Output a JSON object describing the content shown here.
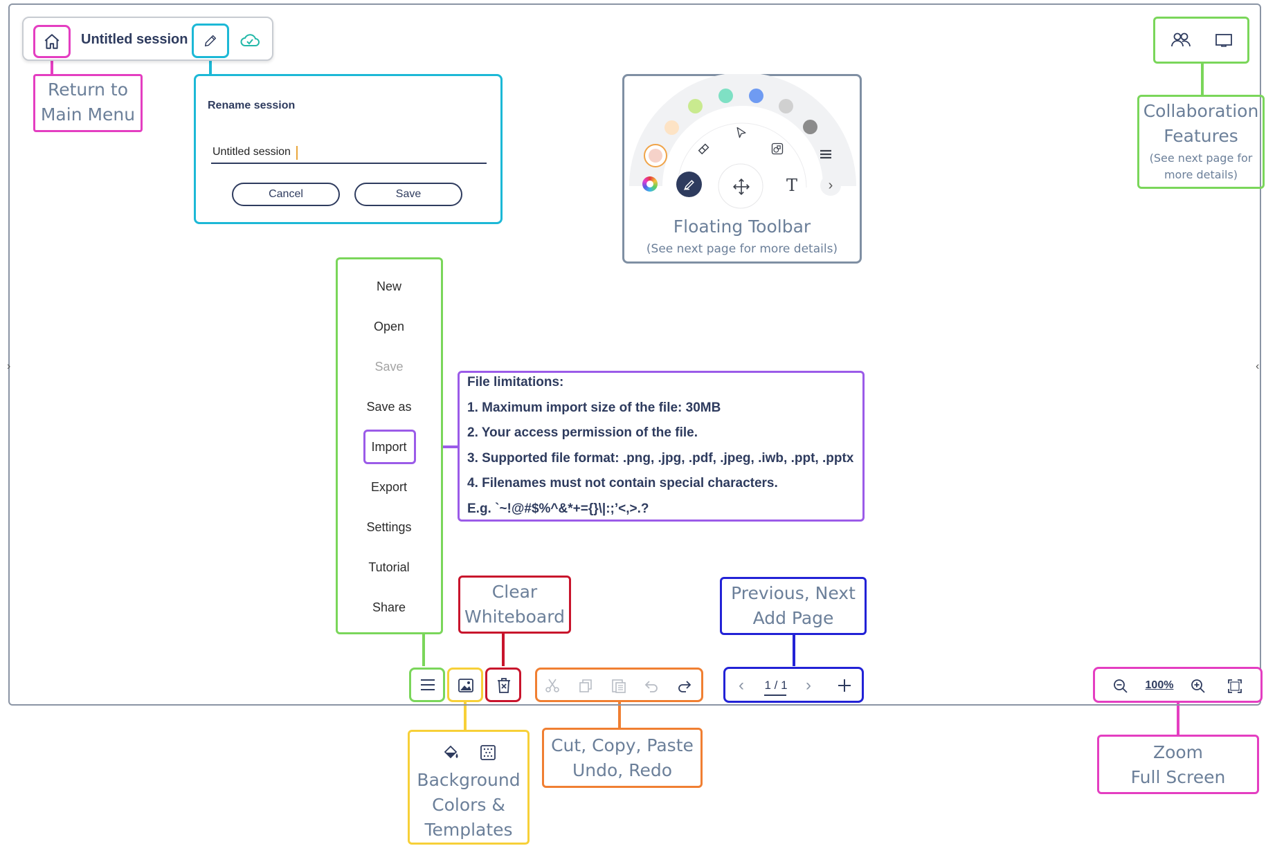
{
  "session": {
    "title": "Untitled session",
    "icons": [
      "home-icon",
      "pencil-icon",
      "cloud-check-icon"
    ]
  },
  "rename_dialog": {
    "title": "Rename session",
    "value": "Untitled session",
    "cancel_label": "Cancel",
    "save_label": "Save"
  },
  "floating_toolbar": {
    "label": "Floating Toolbar",
    "sublabel": "(See next page for more details)",
    "palette": [
      "#f6d2c9",
      "#fde3c5",
      "#c9ea8f",
      "#7fe0c4",
      "#6f9bf2",
      "#d0d0d0",
      "#8b8b8b"
    ],
    "tools": [
      "color-wheel-icon",
      "highlighter-icon",
      "eraser-icon",
      "pointer-icon",
      "move-icon",
      "shapes-icon",
      "text-icon",
      "menu-icon",
      "chevron-right-icon"
    ]
  },
  "file_menu": {
    "items": [
      "New",
      "Open",
      "Save",
      "Save as",
      "Import",
      "Export",
      "Settings",
      "Tutorial",
      "Share"
    ],
    "disabled_item": "Save"
  },
  "file_limitations": {
    "title": "File limitations:",
    "lines": [
      "1. Maximum import size of the file: 30MB",
      "2. Your access permission of the file.",
      "3. Supported file format: .png, .jpg, .pdf, .jpeg, .iwb, .ppt, .pptx",
      "4. Filenames must not contain special characters.",
      "E.g. `~!@#$%^&*+={}\\|:;’<,>.?"
    ]
  },
  "annotations": {
    "return_main": "Return to\nMain Menu",
    "collaboration": "Collaboration\nFeatures",
    "collaboration_sub": "(See next page for\nmore details)",
    "clear": "Clear\nWhiteboard",
    "pages": "Previous, Next\nAdd Page",
    "background": "Background\nColors &\nTemplates",
    "edit": "Cut, Copy, Paste\nUndo, Redo",
    "zoom": "Zoom\nFull Screen"
  },
  "bottom_bar": {
    "page_indicator": "1 / 1",
    "zoom_level": "100%"
  },
  "colors": {
    "magenta": "#e43ec1",
    "cyan": "#1cb8d6",
    "green": "#7ad65a",
    "purple": "#9b5be8",
    "red": "#c8142c",
    "yellow": "#f7d038",
    "orange": "#f07f32",
    "blue": "#2222d6",
    "navy": "#2e3b5e"
  }
}
